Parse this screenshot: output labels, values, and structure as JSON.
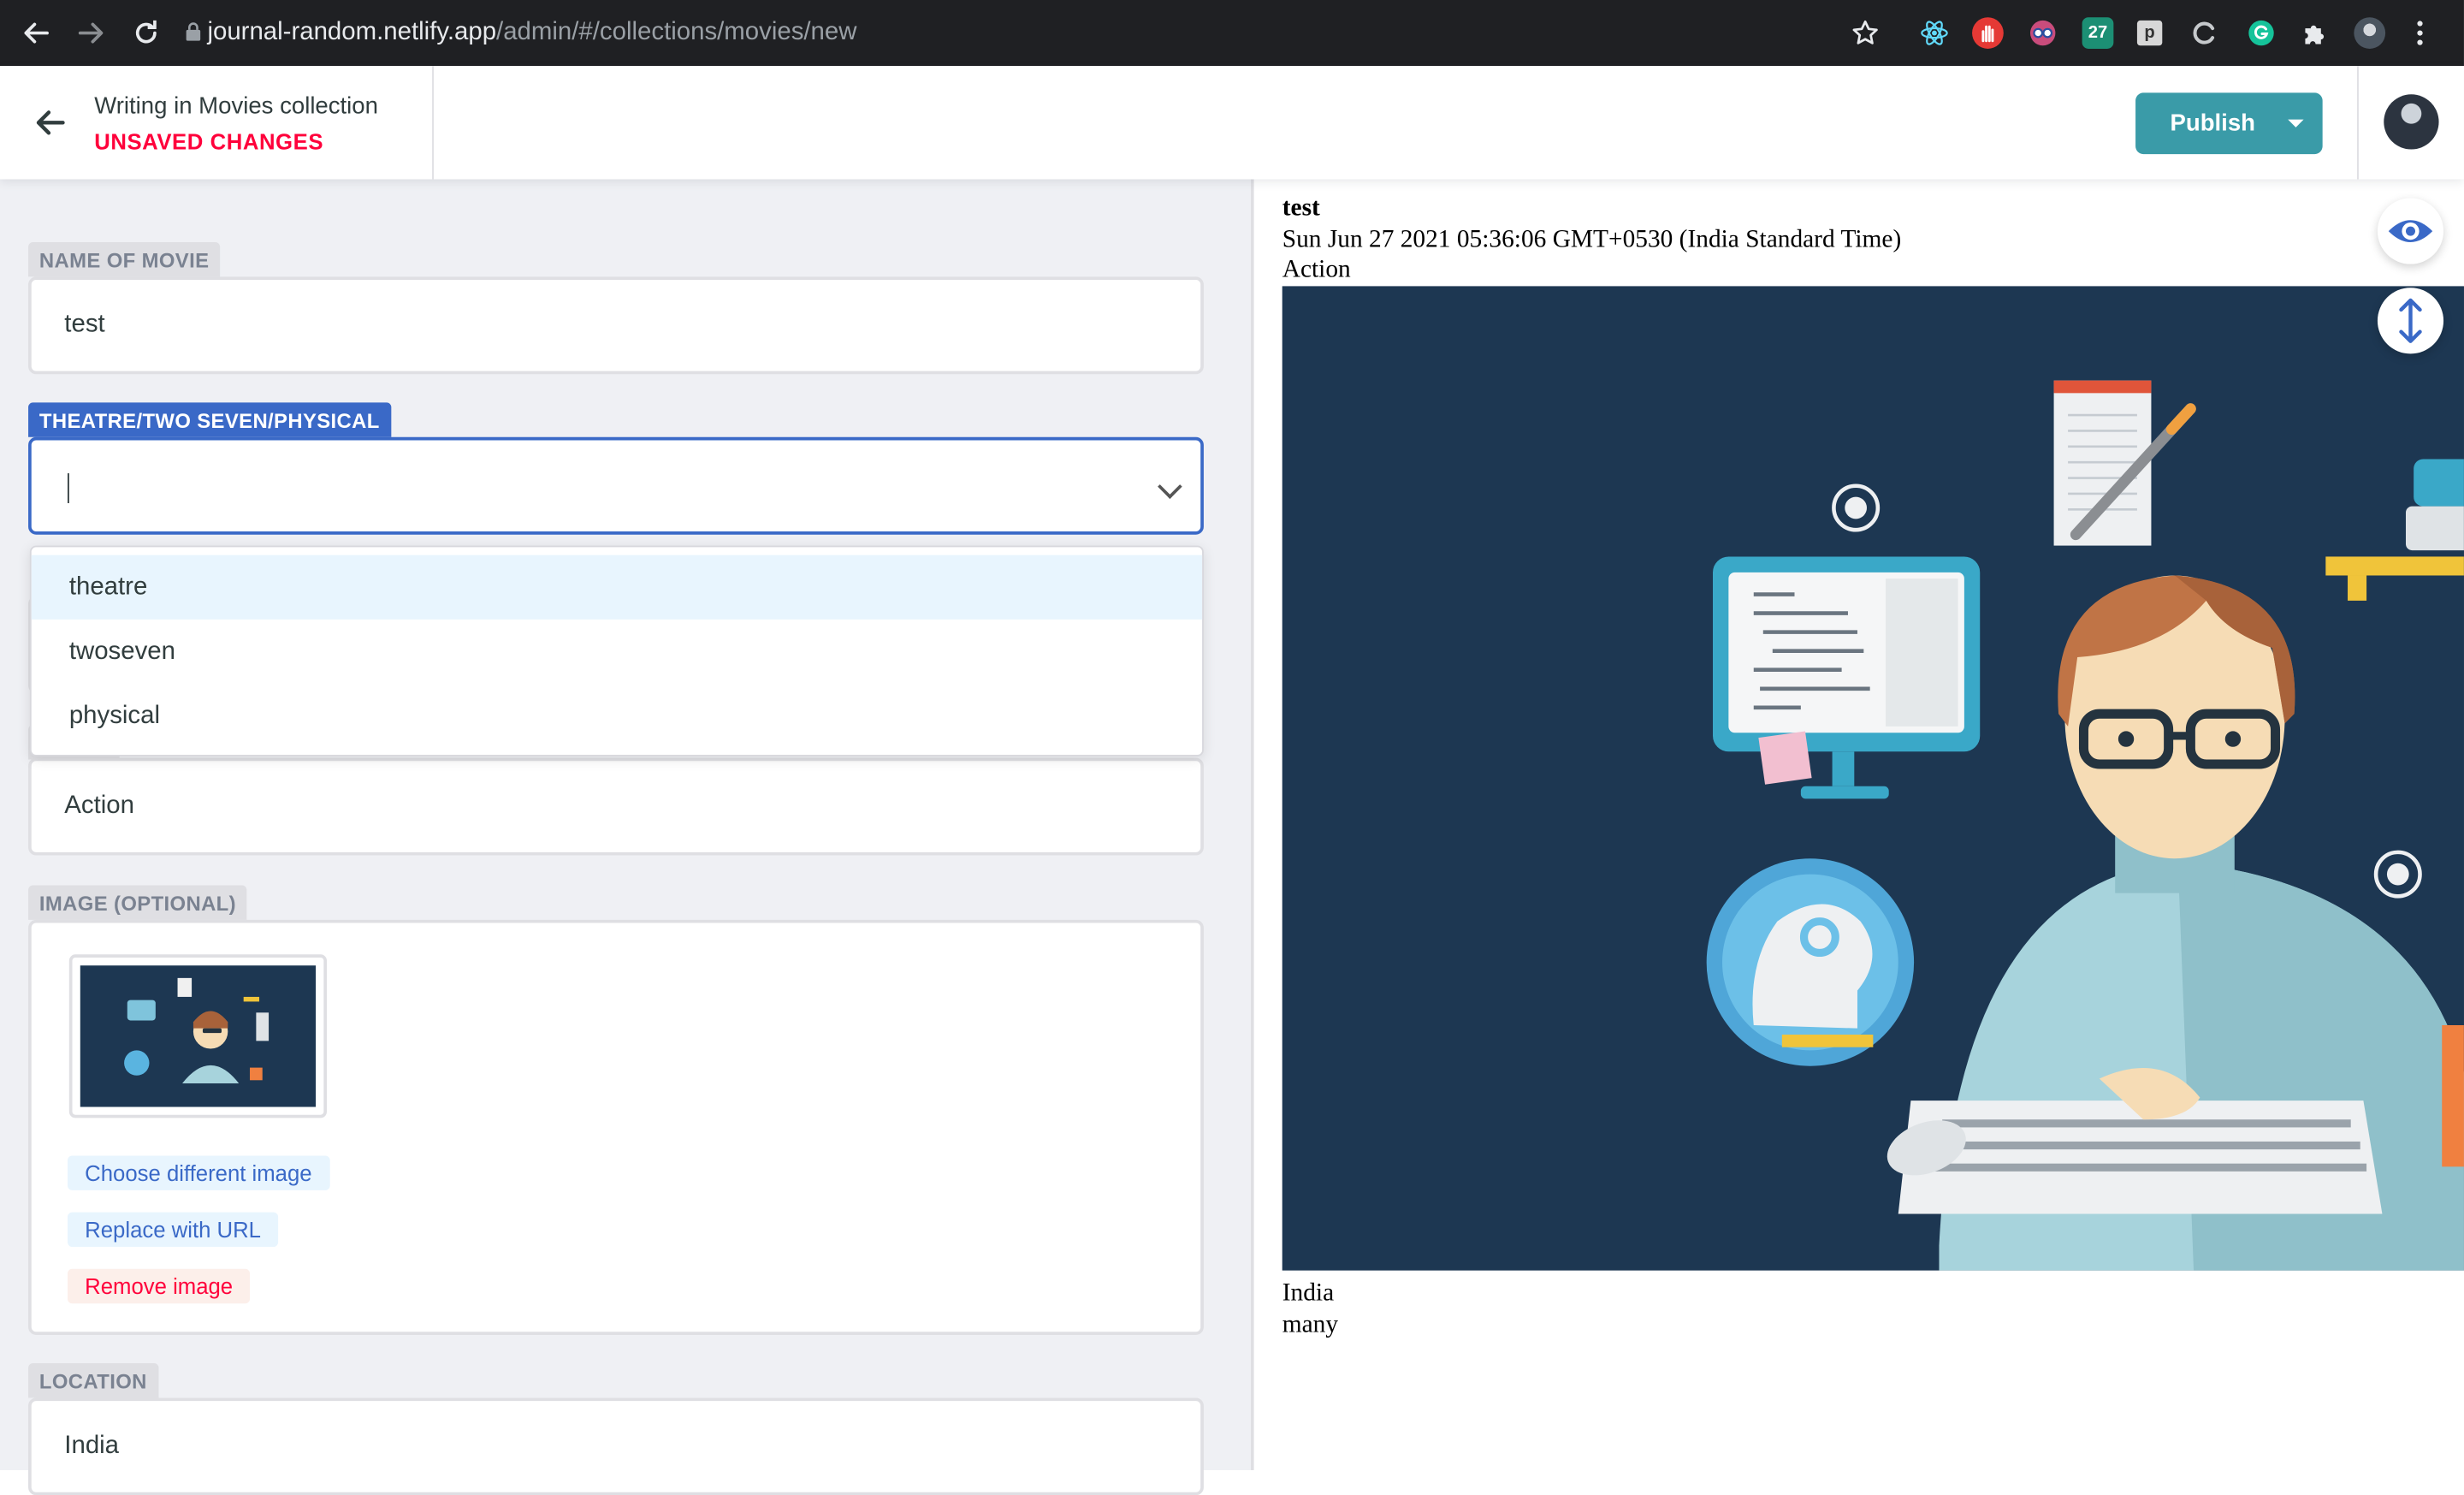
{
  "browser": {
    "url_host": "journal-random.netlify.app",
    "url_path": "/admin/#/collections/movies/new",
    "ext_27_label": "27",
    "ext_p_label": "p"
  },
  "header": {
    "writing_label": "Writing in Movies collection",
    "status": "UNSAVED CHANGES",
    "publish_label": "Publish"
  },
  "form": {
    "name": {
      "label": "NAME OF MOVIE",
      "value": "test"
    },
    "tag": {
      "label": "THEATRE/TWO SEVEN/PHYSICAL",
      "value": "",
      "options": [
        "theatre",
        "twoseven",
        "physical"
      ],
      "highlighted_option": "theatre"
    },
    "genre": {
      "value": "Action"
    },
    "image": {
      "label": "IMAGE (OPTIONAL)",
      "choose_label": "Choose different image",
      "replace_label": "Replace with URL",
      "remove_label": "Remove image"
    },
    "location": {
      "label": "LOCATION",
      "value": "India"
    }
  },
  "preview": {
    "title": "test",
    "date": "Sun Jun 27 2021 05:36:06 GMT+0530 (India Standard Time)",
    "genre": "Action",
    "location": "India",
    "extra": "many"
  },
  "colors": {
    "chrome_bg": "#1f2023",
    "publish_bg": "#3a9ba8",
    "unsaved_red": "#ff003b",
    "active_blue": "#3a69c7",
    "editor_bg": "#eff0f4",
    "image_bg": "#1d3752"
  },
  "icons": {
    "back": "arrow-left-icon",
    "forward": "arrow-right-icon",
    "reload": "reload-icon",
    "lock": "lock-icon",
    "star": "star-icon",
    "extensions": "puzzle-icon",
    "menu": "kebab-menu-icon",
    "preview_toggle": "eye-icon",
    "scroll_sync": "vertical-arrows-icon"
  }
}
